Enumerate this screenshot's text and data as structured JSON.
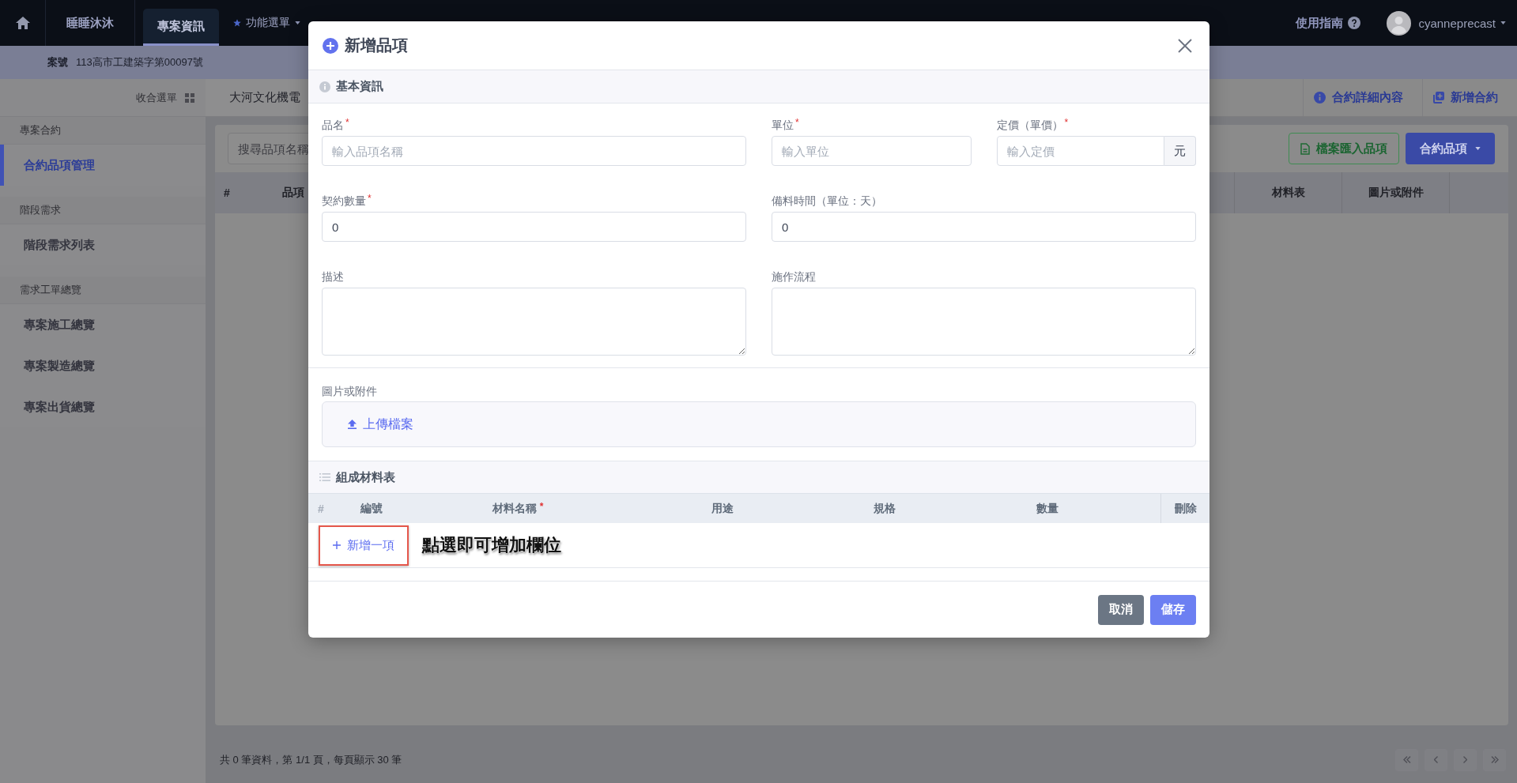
{
  "top_nav": {
    "items": [
      {
        "label": "睡睡沐沐",
        "kind": "tab",
        "selected": false
      },
      {
        "label": "專案資訊",
        "kind": "tab",
        "selected": true
      },
      {
        "label": "功能選單",
        "kind": "menu",
        "selected": false
      }
    ],
    "help": "使用指南",
    "user": "cyanneprecast"
  },
  "case_bar": {
    "label": "案號",
    "value": "113高市工建築字第00097號"
  },
  "sidebar": {
    "collapse": "收合選單",
    "groups": [
      {
        "title": "專案合約",
        "items": [
          {
            "label": "合約品項管理",
            "selected": true
          }
        ]
      },
      {
        "title": "階段需求",
        "items": [
          {
            "label": "階段需求列表",
            "selected": false
          }
        ]
      },
      {
        "title": "需求工單總覽",
        "items": [
          {
            "label": "專案施工總覽",
            "selected": false
          },
          {
            "label": "專案製造總覽",
            "selected": false
          },
          {
            "label": "專案出貨總覽",
            "selected": false
          }
        ]
      }
    ]
  },
  "content_tabs": {
    "tabs": [
      {
        "label": "大河文化機電",
        "selected": true
      }
    ],
    "actions": [
      {
        "label": "合約詳細內容",
        "kind": "info"
      },
      {
        "label": "新增合約",
        "kind": "add"
      }
    ]
  },
  "toolbar": {
    "search": {
      "placeholder": "搜尋品項名稱"
    },
    "buttons": [
      {
        "label": "檔案匯入品項",
        "kind": "import"
      },
      {
        "label": "合約品項",
        "kind": "dropdown"
      }
    ]
  },
  "table": {
    "columns": [
      {
        "label": "#"
      },
      {
        "label": "品項"
      },
      {
        "label": "材料表"
      },
      {
        "label": "圖片或附件"
      }
    ]
  },
  "footer": {
    "summary": "共 0 筆資料，第 1/1 頁，每頁顯示 30 筆"
  },
  "dialog": {
    "title": "新增品項",
    "basic": {
      "title": "基本資訊",
      "rows": [
        {
          "fields": [
            {
              "label": "品名",
              "mark": "*",
              "kind": "input",
              "placeholder": "輸入品項名稱"
            },
            {
              "label": "單位",
              "mark": "*",
              "kind": "input",
              "placeholder": "輸入單位"
            },
            {
              "label": "定價（單價）",
              "mark": "*",
              "kind": "addon",
              "placeholder": "輸入定價",
              "suffix": "元"
            }
          ]
        },
        {
          "fields": [
            {
              "label": "契約數量",
              "mark": "*",
              "kind": "input",
              "value": "0"
            },
            {
              "label": "備料時間（單位：天）",
              "kind": "input",
              "value": "0"
            }
          ]
        },
        {
          "fields": [
            {
              "label": "描述",
              "kind": "textarea"
            },
            {
              "label": "施作流程",
              "kind": "textarea"
            }
          ]
        }
      ]
    },
    "attachments": {
      "label": "圖片或附件",
      "upload": "上傳檔案"
    },
    "materials": {
      "title": "組成材料表",
      "columns": [
        {
          "label": "#"
        },
        {
          "label": "編號"
        },
        {
          "label": "材料名稱",
          "mark": "*"
        },
        {
          "label": "用途"
        },
        {
          "label": "規格"
        },
        {
          "label": "數量"
        },
        {
          "label": "刪除"
        }
      ],
      "add_button": "新增一項"
    },
    "annotation": {
      "text": "點選即可增加欄位",
      "highlight": true
    },
    "buttons": [
      {
        "label": "取消",
        "kind": "cancel"
      },
      {
        "label": "儲存",
        "kind": "save"
      }
    ]
  }
}
